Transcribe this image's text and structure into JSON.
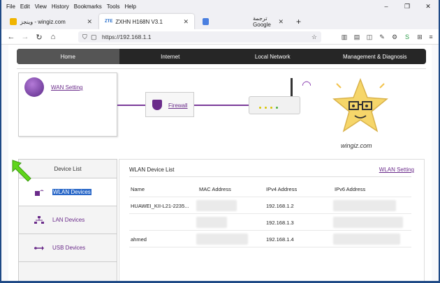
{
  "menu": [
    "File",
    "Edit",
    "View",
    "History",
    "Bookmarks",
    "Tools",
    "Help"
  ],
  "window_controls": [
    "–",
    "❐",
    "✕"
  ],
  "tabs": [
    {
      "label": "وينجز - wingiz.com",
      "active": false
    },
    {
      "label": "ZXHN H168N V3.1",
      "active": true
    },
    {
      "label": "ترجمة Google",
      "active": false
    }
  ],
  "tab_brand": "ZTE",
  "new_tab": "+",
  "url": "https://192.168.1.1",
  "router_nav": [
    "Home",
    "Internet",
    "Local Network",
    "Management & Diagnosis"
  ],
  "wan_setting": "WAN Setting",
  "firewall": "Firewall",
  "mascot_label": "wingiz.com",
  "left_panel": {
    "title": "Device List",
    "items": [
      "WLAN Devices",
      "LAN Devices",
      "USB Devices"
    ]
  },
  "right_panel": {
    "title": "WLAN Device List",
    "link": "WLAN Setting",
    "columns": [
      "Name",
      "MAC Address",
      "IPv4 Address",
      "IPv6 Address"
    ],
    "rows": [
      {
        "name": "HUAWEI_KII-L21-2235...",
        "ipv4": "192.168.1.2"
      },
      {
        "name": "",
        "ipv4": "192.168.1.3"
      },
      {
        "name": "ahmed",
        "ipv4": "192.168.1.4"
      }
    ]
  },
  "colors": {
    "accent": "#6a2b8a",
    "nav_bg": "#262626",
    "selection": "#2a68c8"
  }
}
